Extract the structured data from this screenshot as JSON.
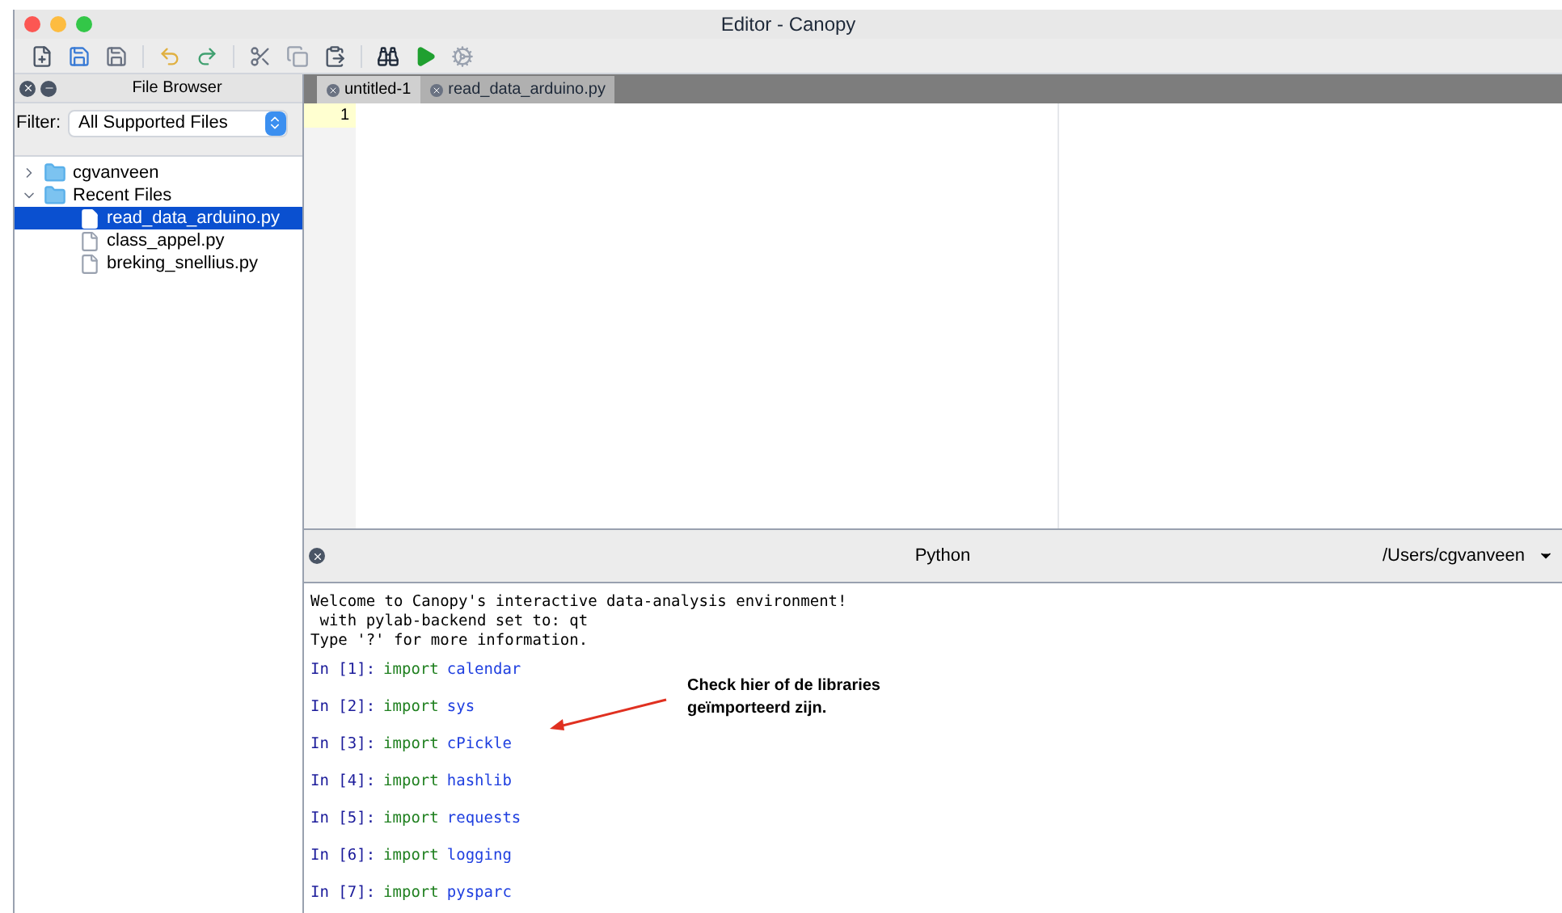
{
  "window": {
    "title": "Editor - Canopy"
  },
  "file_browser": {
    "title": "File Browser",
    "filter_label": "Filter:",
    "filter_value": "All Supported Files",
    "tree": [
      {
        "label": "cgvanveen",
        "kind": "folder",
        "expanded": false,
        "selected": false
      },
      {
        "label": "Recent Files",
        "kind": "folder",
        "expanded": true,
        "selected": false,
        "children": [
          {
            "label": "read_data_arduino.py",
            "kind": "file",
            "selected": true
          },
          {
            "label": "class_appel.py",
            "kind": "file",
            "selected": false
          },
          {
            "label": "breking_snellius.py",
            "kind": "file",
            "selected": false
          }
        ]
      }
    ]
  },
  "editor": {
    "tabs": [
      {
        "label": "untitled-1",
        "selected": true
      },
      {
        "label": "read_data_arduino.py",
        "selected": false
      }
    ],
    "line_numbers": [
      "1"
    ]
  },
  "python": {
    "title": "Python",
    "directory": "/Users/cgvanveen",
    "banner": [
      "Welcome to Canopy's interactive data-analysis environment!",
      " with pylab-backend set to: qt",
      "Type '?' for more information."
    ],
    "inputs": [
      {
        "prompt": "In [1]:",
        "keyword": "import",
        "module": "calendar"
      },
      {
        "prompt": "In [2]:",
        "keyword": "import",
        "module": "sys"
      },
      {
        "prompt": "In [3]:",
        "keyword": "import",
        "module": "cPickle"
      },
      {
        "prompt": "In [4]:",
        "keyword": "import",
        "module": "hashlib"
      },
      {
        "prompt": "In [5]:",
        "keyword": "import",
        "module": "requests"
      },
      {
        "prompt": "In [6]:",
        "keyword": "import",
        "module": "logging"
      },
      {
        "prompt": "In [7]:",
        "keyword": "import",
        "module": "pysparc"
      }
    ]
  },
  "annotation": {
    "lines": [
      "Check hier of de libraries",
      "geïmporteerd zijn."
    ]
  }
}
